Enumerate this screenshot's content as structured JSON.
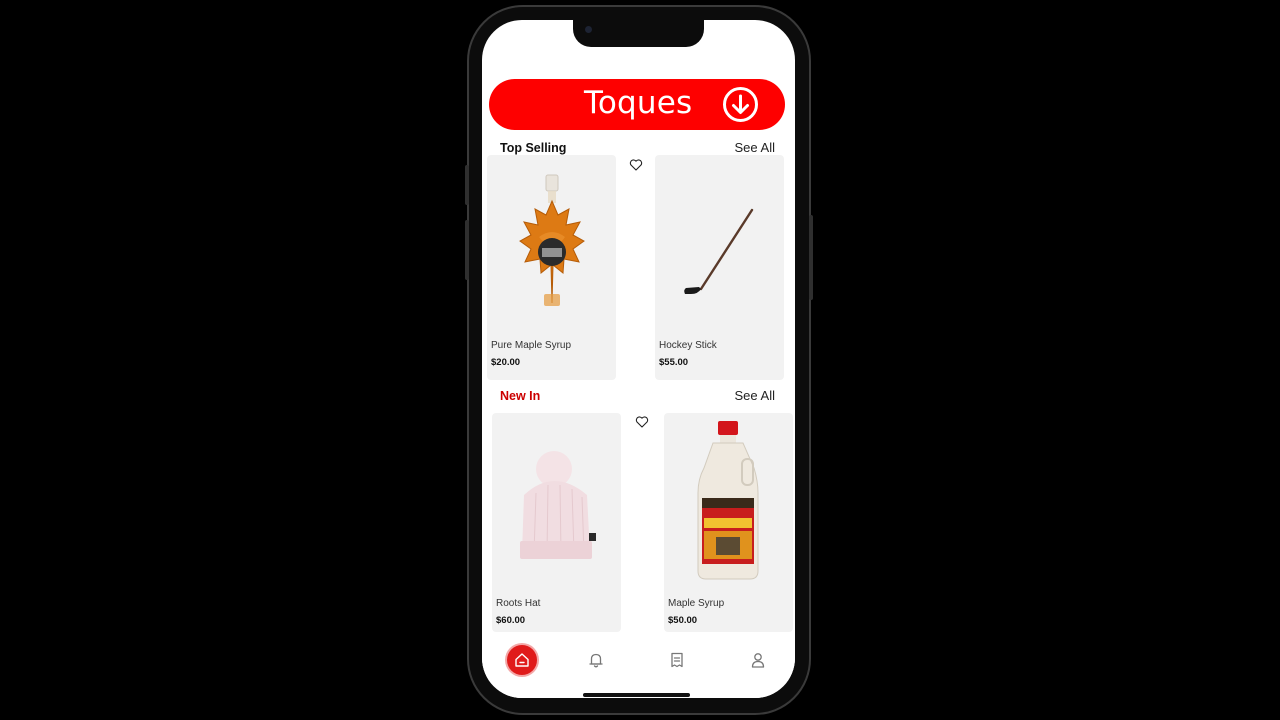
{
  "banner": {
    "title": "Toques",
    "icon": "arrow-down-circle-icon"
  },
  "sections": [
    {
      "title": "Top Selling",
      "title_color": "#111111",
      "see_all": "See All",
      "products": [
        {
          "name": "Pure Maple Syrup",
          "price": "$20.00",
          "image": "maple-leaf-syrup-bottle"
        },
        {
          "name": "Hockey Stick",
          "price": "$55.00",
          "image": "hockey-stick"
        }
      ]
    },
    {
      "title": "New In",
      "title_color": "#cc0000",
      "see_all": "See All",
      "products": [
        {
          "name": "Roots Hat",
          "price": "$60.00",
          "image": "pink-knit-toque"
        },
        {
          "name": "Maple Syrup",
          "price": "$50.00",
          "image": "maple-syrup-jug"
        }
      ]
    }
  ],
  "tab_bar": {
    "items": [
      {
        "icon": "home-icon",
        "active": true
      },
      {
        "icon": "bell-icon",
        "active": false
      },
      {
        "icon": "receipt-icon",
        "active": false
      },
      {
        "icon": "user-icon",
        "active": false
      }
    ]
  },
  "colors": {
    "accent": "#fe0000",
    "card_bg": "#f2f2f2",
    "section_highlight": "#cc0000"
  }
}
